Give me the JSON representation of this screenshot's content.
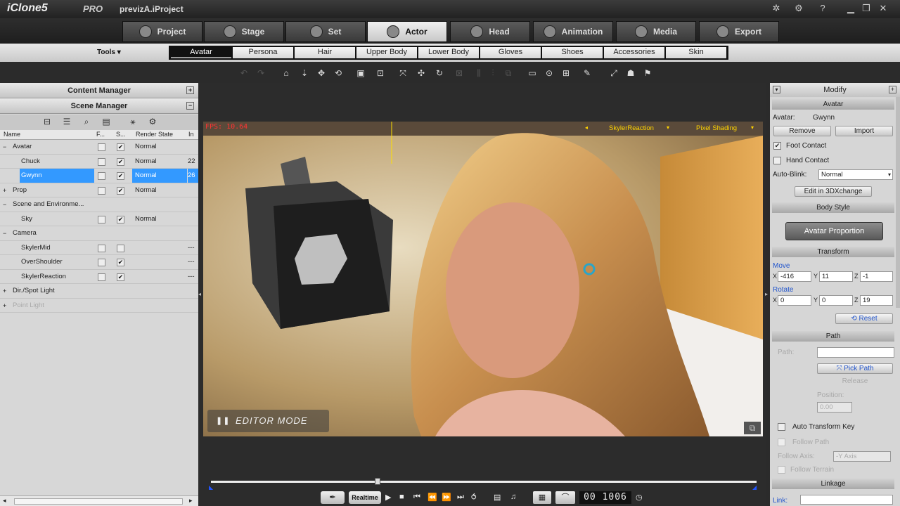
{
  "app": {
    "logo": "iClone5",
    "edition": "PRO",
    "project": "previzA.iProject"
  },
  "main_tabs": [
    "Project",
    "Stage",
    "Set",
    "Actor",
    "Head",
    "Animation",
    "Media",
    "Export"
  ],
  "tools_label": "Tools ▾",
  "sub_tabs": [
    "Avatar",
    "Persona",
    "Hair",
    "Upper Body",
    "Lower Body",
    "Gloves",
    "Shoes",
    "Accessories",
    "Skin"
  ],
  "left": {
    "content_manager": "Content Manager",
    "scene_manager": "Scene Manager",
    "columns": {
      "name": "Name",
      "f": "F...",
      "s": "S...",
      "render": "Render State",
      "in": "In"
    },
    "rows": [
      {
        "name": "Avatar",
        "indent": 0,
        "expand": "−",
        "f": true,
        "s": true,
        "render": "Normal",
        "in": ""
      },
      {
        "name": "Chuck",
        "indent": 1,
        "expand": "",
        "f": true,
        "s": true,
        "render": "Normal",
        "in": "22"
      },
      {
        "name": "Gwynn",
        "indent": 1,
        "expand": "",
        "f": true,
        "s": true,
        "render": "Normal",
        "in": "26",
        "selected": true
      },
      {
        "name": "Prop",
        "indent": 0,
        "expand": "+",
        "f": true,
        "s": true,
        "render": "Normal",
        "in": ""
      },
      {
        "name": "Scene and Environme...",
        "indent": 0,
        "expand": "−",
        "f": false,
        "s": false,
        "render": "",
        "in": ""
      },
      {
        "name": "Sky",
        "indent": 1,
        "expand": "",
        "f": false,
        "s": true,
        "render": "Normal",
        "in": ""
      },
      {
        "name": "Camera",
        "indent": 0,
        "expand": "−",
        "f": false,
        "s": false,
        "render": "",
        "in": ""
      },
      {
        "name": "SkylerMid",
        "indent": 1,
        "expand": "",
        "f": true,
        "s": true,
        "render": "",
        "in": "---"
      },
      {
        "name": "OverShoulder",
        "indent": 1,
        "expand": "",
        "f": true,
        "s": true,
        "render": "",
        "in": "---"
      },
      {
        "name": "SkylerReaction",
        "indent": 1,
        "expand": "",
        "f": true,
        "s": true,
        "render": "",
        "in": "---"
      },
      {
        "name": "Dir./Spot Light",
        "indent": 0,
        "expand": "+",
        "f": false,
        "s": false,
        "render": "",
        "in": ""
      },
      {
        "name": "Point Light",
        "indent": 0,
        "expand": "+",
        "f": false,
        "s": false,
        "render": "",
        "in": "",
        "dim": true
      }
    ],
    "checks": {
      "f": [
        false,
        false,
        false,
        false,
        false,
        false,
        false,
        false,
        false,
        false,
        false,
        false
      ],
      "s": [
        true,
        true,
        true,
        true,
        false,
        true,
        false,
        false,
        true,
        true,
        false,
        false
      ]
    }
  },
  "viewport": {
    "fps": "FPS: 10.64",
    "camera": "SkylerReaction",
    "shading": "Pixel Shading",
    "mode": "EDITOR MODE"
  },
  "playback": {
    "realtime": "Realtime",
    "frame": "00 1006"
  },
  "modify": {
    "title": "Modify",
    "avatar_section": "Avatar",
    "avatar_label": "Avatar:",
    "avatar_name": "Gwynn",
    "remove": "Remove",
    "import": "Import",
    "foot_contact": "Foot Contact",
    "foot_checked": true,
    "hand_contact": "Hand Contact",
    "hand_checked": false,
    "autoblink_label": "Auto-Blink:",
    "autoblink_value": "Normal",
    "edit_3dx": "Edit in 3DXchange",
    "body_style": "Body Style",
    "avatar_proportion": "Avatar Proportion",
    "transform": "Transform",
    "move": "Move",
    "move_x": "-416",
    "move_y": "11",
    "move_z": "-1",
    "rotate": "Rotate",
    "rot_x": "0",
    "rot_y": "0",
    "rot_z": "19",
    "reset": "Reset",
    "path": "Path",
    "path_label": "Path:",
    "pick_path": "Pick Path",
    "release": "Release",
    "position": "Position:",
    "position_value": "0.00",
    "auto_transform_key": "Auto Transform Key",
    "follow_path": "Follow Path",
    "follow_axis": "Follow Axis:",
    "follow_axis_value": "-Y Axis",
    "follow_terrain": "Follow Terrain",
    "linkage": "Linkage",
    "link": "Link:"
  }
}
